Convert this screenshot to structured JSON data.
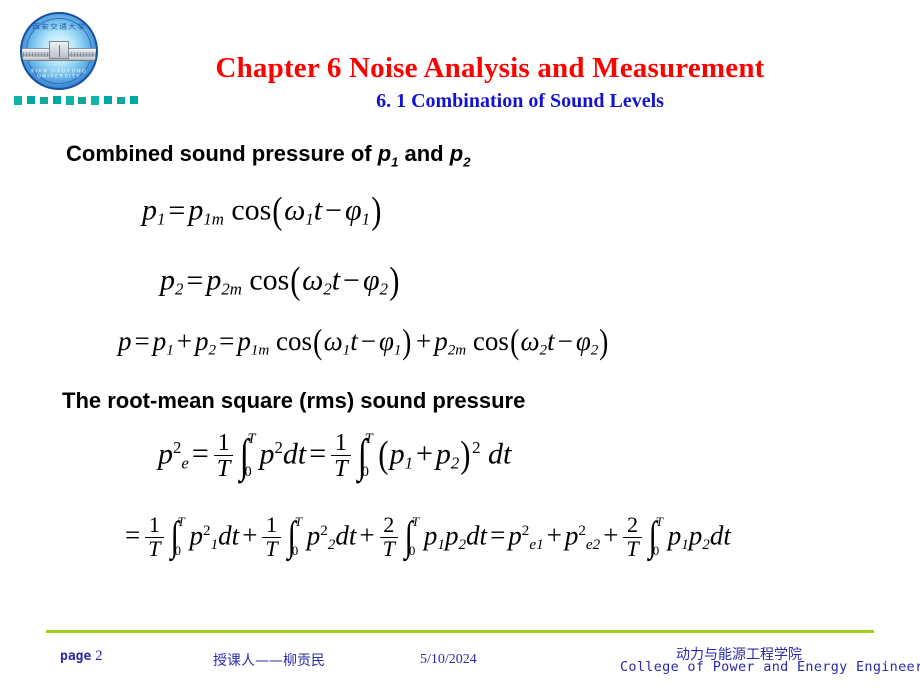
{
  "slide": {
    "title": "Chapter 6  Noise Analysis and Measurement",
    "subtitle": "6. 1 Combination of Sound Levels",
    "title_color": "#fe0000",
    "subtitle_color": "#1313cf"
  },
  "logo": {
    "name": "university-seal",
    "ring_text_top": "西安交通大学",
    "ring_text_bottom": "XIAN JIAOTONG UNIVERSITY",
    "accent_color": "#15499c",
    "dash_color": "#00a9a0"
  },
  "headings": {
    "combined": {
      "before": "Combined sound pressure of ",
      "var1": "p",
      "var1_sub": "1",
      "middle": " and ",
      "var2": "p",
      "var2_sub": "2"
    },
    "rms": "The root-mean square (rms) sound pressure"
  },
  "equations": {
    "eq_p1": {
      "lhs_var": "p",
      "lhs_sub": "1",
      "eq": "=",
      "amp_var": "p",
      "amp_sub": "1m",
      "fn": "cos",
      "open": "(",
      "omega": "ω",
      "omega_sub": "1",
      "t": "t",
      "minus": "−",
      "phi": "φ",
      "phi_sub": "1",
      "close": ")"
    },
    "eq_p2": {
      "lhs_var": "p",
      "lhs_sub": "2",
      "eq": "=",
      "amp_var": "p",
      "amp_sub": "2m",
      "fn": "cos",
      "open": "(",
      "omega": "ω",
      "omega_sub": "2",
      "t": "t",
      "minus": "−",
      "phi": "φ",
      "phi_sub": "2",
      "close": ")"
    },
    "eq_sum": {
      "p": "p",
      "eq1": "=",
      "p1": "p",
      "p1_sub": "1",
      "plus": "+",
      "p2": "p",
      "p2_sub": "2",
      "eq2": "=",
      "amp1": "p",
      "amp1_sub": "1m",
      "fn1": "cos",
      "open1": "(",
      "omega1": "ω",
      "omega1_sub": "1",
      "t1": "t",
      "minus1": "−",
      "phi1": "φ",
      "phi1_sub": "1",
      "close1": ")",
      "plus2": "+",
      "amp2": "p",
      "amp2_sub": "2m",
      "fn2": "cos",
      "open2": "(",
      "omega2": "ω",
      "omega2_sub": "2",
      "t2": "t",
      "minus2": "−",
      "phi2": "φ",
      "phi2_sub": "2",
      "close2": ")"
    },
    "eq_rms1": {
      "lhs": "p",
      "lhs_sub": "e",
      "lhs_sup": "2",
      "eq1": "=",
      "frac_num": "1",
      "frac_den": "T",
      "int_up": "T",
      "int_lo": "0",
      "integrand1": "p",
      "integrand1_sup": "2",
      "dt1": "dt",
      "eq2": "=",
      "frac2_num": "1",
      "frac2_den": "T",
      "int2_up": "T",
      "int2_lo": "0",
      "open": "(",
      "p1": "p",
      "p1_sub": "1",
      "plus": "+",
      "p2": "p",
      "p2_sub": "2",
      "close": ")",
      "close_sup": "2",
      "dt2": "dt"
    },
    "eq_rms2": {
      "eq0": "=",
      "f1_num": "1",
      "f1_den": "T",
      "i1_up": "T",
      "i1_lo": "0",
      "g1": "p",
      "g1_sub": "1",
      "g1_sup": "2",
      "dt1": "dt",
      "plus1": "+",
      "f2_num": "1",
      "f2_den": "T",
      "i2_up": "T",
      "i2_lo": "0",
      "g2": "p",
      "g2_sub": "2",
      "g2_sup": "2",
      "dt2": "dt",
      "plus2": "+",
      "f3_num": "2",
      "f3_den": "T",
      "i3_up": "T",
      "i3_lo": "0",
      "g3a": "p",
      "g3a_sub": "1",
      "g3b": "p",
      "g3b_sub": "2",
      "dt3": "dt",
      "eq1": "=",
      "r1": "p",
      "r1_sub": "e1",
      "r1_sup": "2",
      "plus3": "+",
      "r2": "p",
      "r2_sub": "e2",
      "r2_sup": "2",
      "plus4": "+",
      "f4_num": "2",
      "f4_den": "T",
      "i4_up": "T",
      "i4_lo": "0",
      "g4a": "p",
      "g4a_sub": "1",
      "g4b": "p",
      "g4b_sub": "2",
      "dt4": "dt"
    }
  },
  "footer": {
    "page_label": "page",
    "page_number": "2",
    "author": "授课人——柳贡民",
    "date": "5/10/2024",
    "college_cn": "动力与能源工程学院",
    "college_en": "College of Power and Energy Engineering",
    "rule_color": "#9ed11a",
    "text_color": "#2b2ba8"
  }
}
